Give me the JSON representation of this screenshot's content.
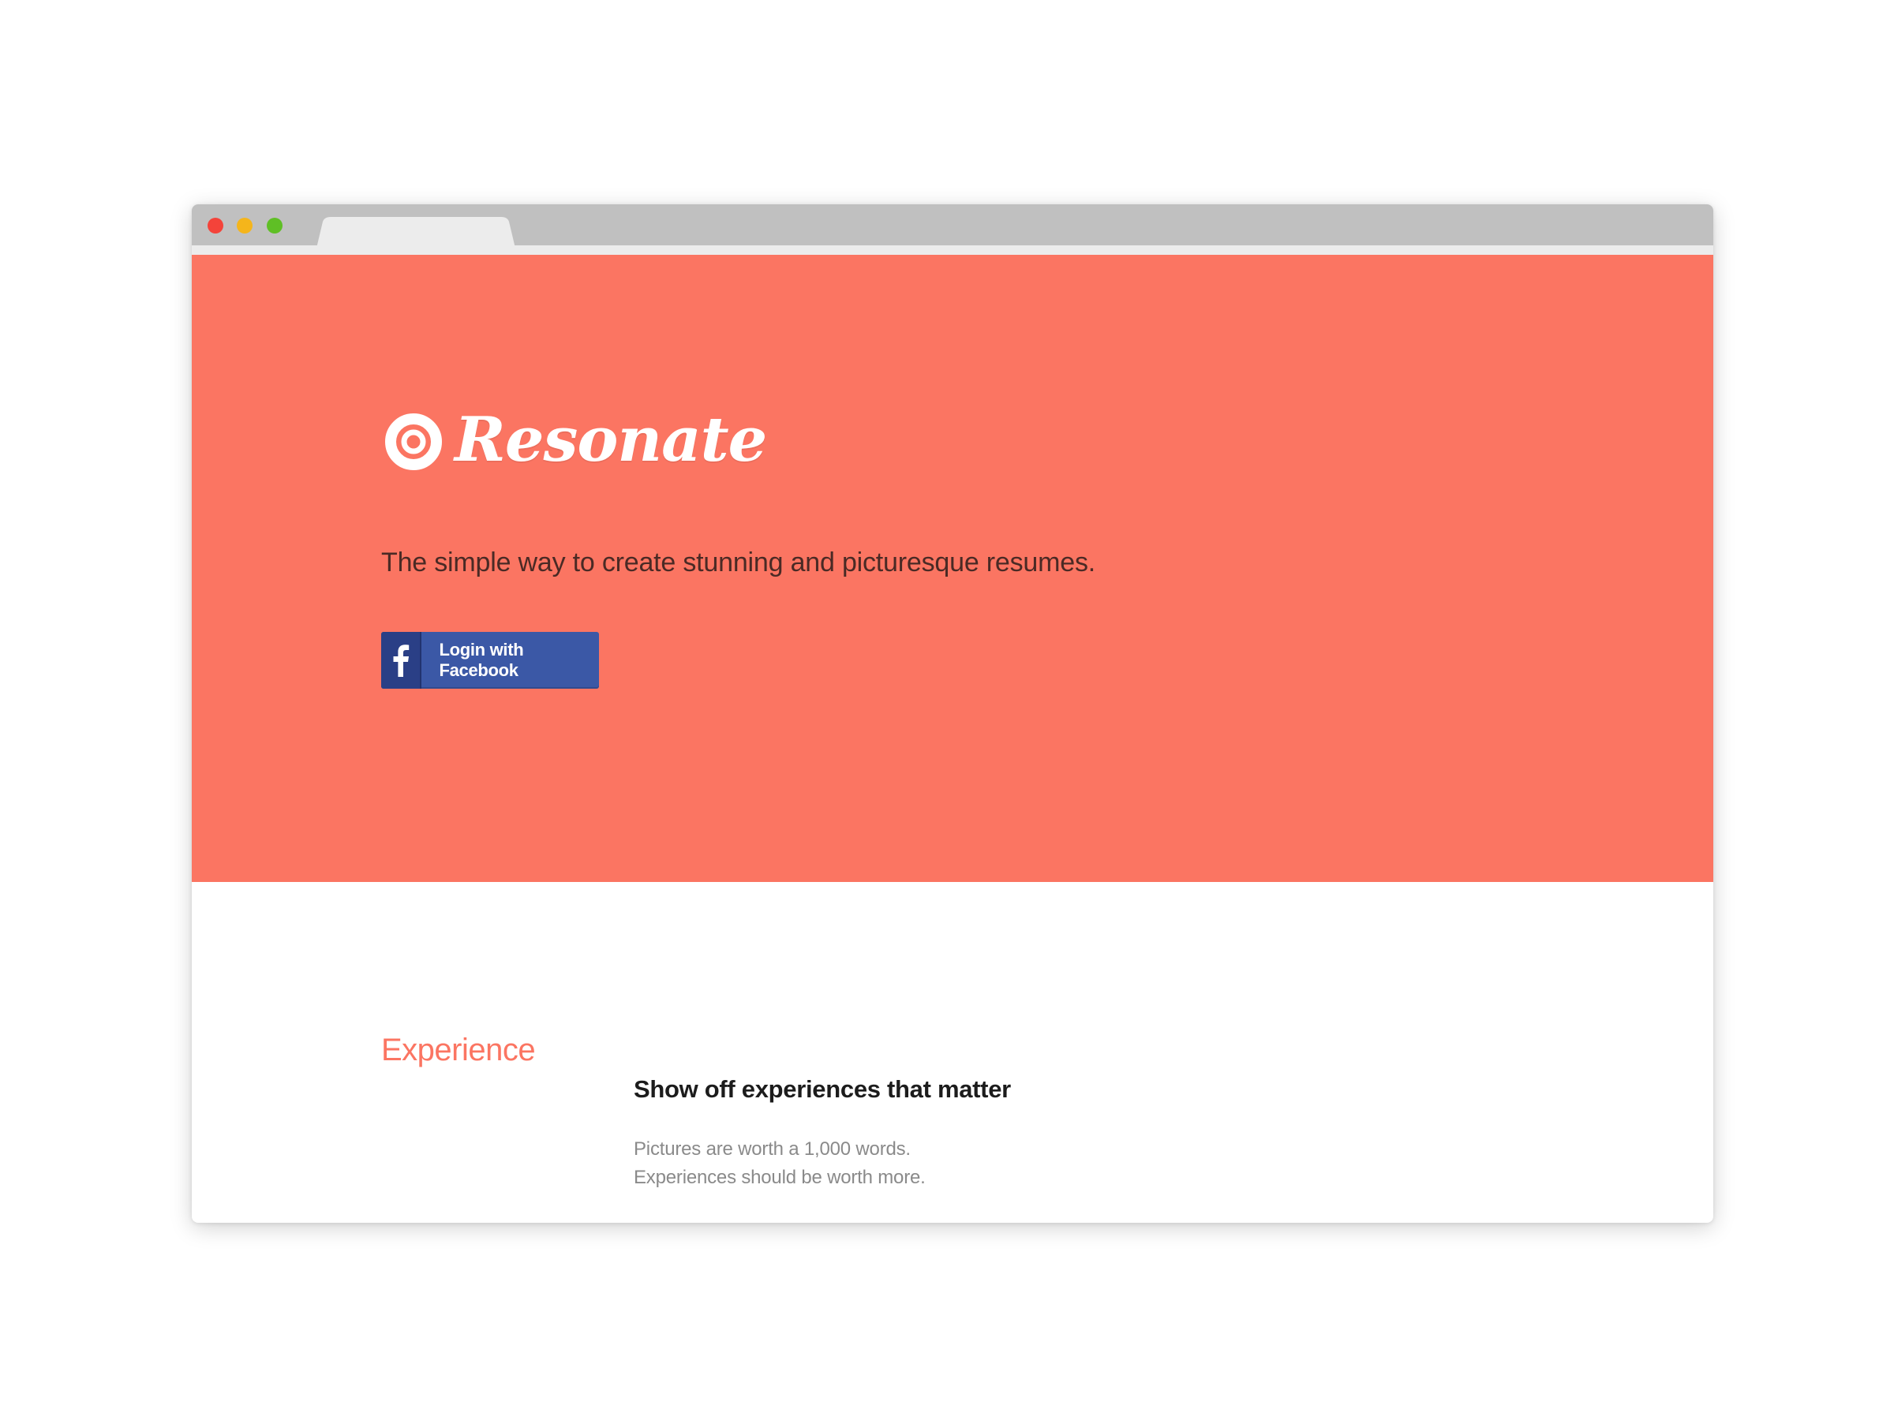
{
  "colors": {
    "hero_background": "#fb7562",
    "accent": "#fb7562",
    "facebook_blue": "#3b58a6",
    "titlebar": "#c0c0c0"
  },
  "window_controls": {
    "icons": [
      "close-dot-icon",
      "minimize-dot-icon",
      "maximize-dot-icon"
    ]
  },
  "hero": {
    "logo_text": "Resonate",
    "tagline": "The simple way to create stunning and picturesque resumes.",
    "facebook_button": {
      "label": "Login with Facebook",
      "icon": "facebook-icon"
    }
  },
  "features": {
    "section_label": "Experience",
    "title": "Show off experiences that matter",
    "description": "Pictures are worth a 1,000 words. Experiences should be worth more."
  }
}
